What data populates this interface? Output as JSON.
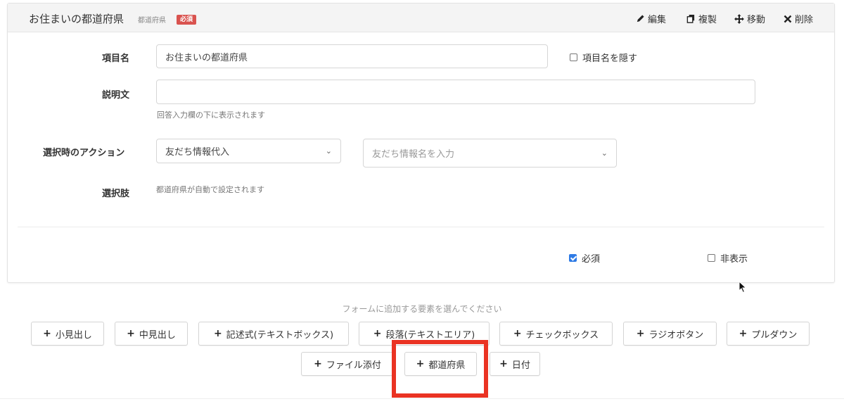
{
  "card": {
    "title": "お住まいの都道府県",
    "subtitle": "都道府県",
    "required_badge": "必須",
    "actions": {
      "edit": "編集",
      "copy": "複製",
      "move": "移動",
      "delete": "削除"
    }
  },
  "form": {
    "item_name_label": "項目名",
    "item_name_value": "お住まいの都道府県",
    "hide_name_label": "項目名を隠す",
    "hide_name_checked": false,
    "description_label": "説明文",
    "description_value": "",
    "description_help": "回答入力欄の下に表示されます",
    "action_label": "選択時のアクション",
    "action_select_value": "友だち情報代入",
    "friend_info_placeholder": "友だち情報名を入力",
    "choices_label": "選択肢",
    "choices_note": "都道府県が自動で設定されます",
    "required_label": "必須",
    "required_checked": true,
    "hidden_label": "非表示",
    "hidden_checked": false
  },
  "palette": {
    "prompt": "フォームに追加する要素を選んでください",
    "buttons": [
      "小見出し",
      "中見出し",
      "記述式(テキストボックス)",
      "段落(テキストエリア)",
      "チェックボックス",
      "ラジオボタン",
      "プルダウン",
      "ファイル添付",
      "都道府県",
      "日付"
    ]
  },
  "colors": {
    "highlight": "#ea3323",
    "badge": "#d9534f",
    "checkbox_checked": "#2f7be5"
  }
}
